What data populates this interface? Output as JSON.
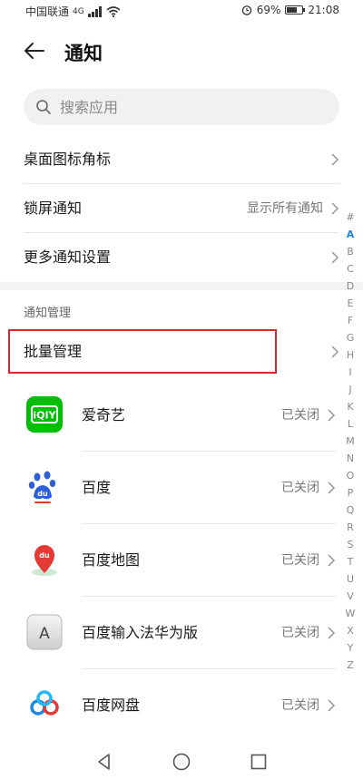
{
  "status": {
    "carrier": "中国联通",
    "net": "4G",
    "battery_text": "69%",
    "battery_level": 0.69,
    "time": "21:08"
  },
  "header": {
    "title": "通知"
  },
  "search": {
    "placeholder": "搜索应用"
  },
  "settings": [
    {
      "label": "桌面图标角标",
      "value": ""
    },
    {
      "label": "锁屏通知",
      "value": "显示所有通知"
    },
    {
      "label": "更多通知设置",
      "value": ""
    }
  ],
  "section": {
    "title": "通知管理"
  },
  "batch": {
    "label": "批量管理"
  },
  "apps": [
    {
      "name": "爱奇艺",
      "status": "已关闭",
      "icon_text": "iQIY"
    },
    {
      "name": "百度",
      "status": "已关闭",
      "icon_text": "du"
    },
    {
      "name": "百度地图",
      "status": "已关闭",
      "icon_text": "du"
    },
    {
      "name": "百度输入法华为版",
      "status": "已关闭",
      "icon_text": "A"
    },
    {
      "name": "百度网盘",
      "status": "已关闭",
      "icon_text": ""
    }
  ],
  "index": [
    "#",
    "A",
    "B",
    "C",
    "D",
    "E",
    "F",
    "G",
    "H",
    "I",
    "J",
    "K",
    "L",
    "M",
    "N",
    "O",
    "P",
    "Q",
    "R",
    "S",
    "T",
    "U",
    "V",
    "W",
    "X",
    "Y",
    "Z"
  ],
  "index_active": "A",
  "colors": {
    "accent": "#1e88e5",
    "highlight": "#d12b2b",
    "iqiyi": "#00be06"
  }
}
